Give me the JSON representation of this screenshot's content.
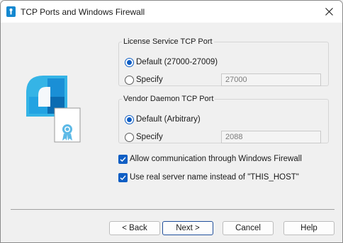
{
  "window": {
    "title": "TCP Ports and Windows Firewall"
  },
  "license_port": {
    "legend": "License Service TCP Port",
    "default_label": "Default (27000-27009)",
    "specify_label": "Specify",
    "port_value": "27000",
    "selected": "default"
  },
  "vendor_port": {
    "legend": "Vendor Daemon TCP Port",
    "default_label": "Default (Arbitrary)",
    "specify_label": "Specify",
    "port_value": "2088",
    "selected": "default"
  },
  "options": {
    "firewall_label": "Allow communication through Windows Firewall",
    "firewall_checked": true,
    "real_name_label": "Use real server name instead of \"THIS_HOST\"",
    "real_name_checked": true
  },
  "buttons": {
    "back": "< Back",
    "next": "Next >",
    "cancel": "Cancel",
    "help": "Help"
  },
  "colors": {
    "accent": "#0f5ec4",
    "icon_light": "#35b4e6",
    "icon_dark": "#0b6cb2"
  },
  "icons": {
    "app": "license-app-icon",
    "hero": "license-certificate-icon",
    "close": "close-icon"
  }
}
